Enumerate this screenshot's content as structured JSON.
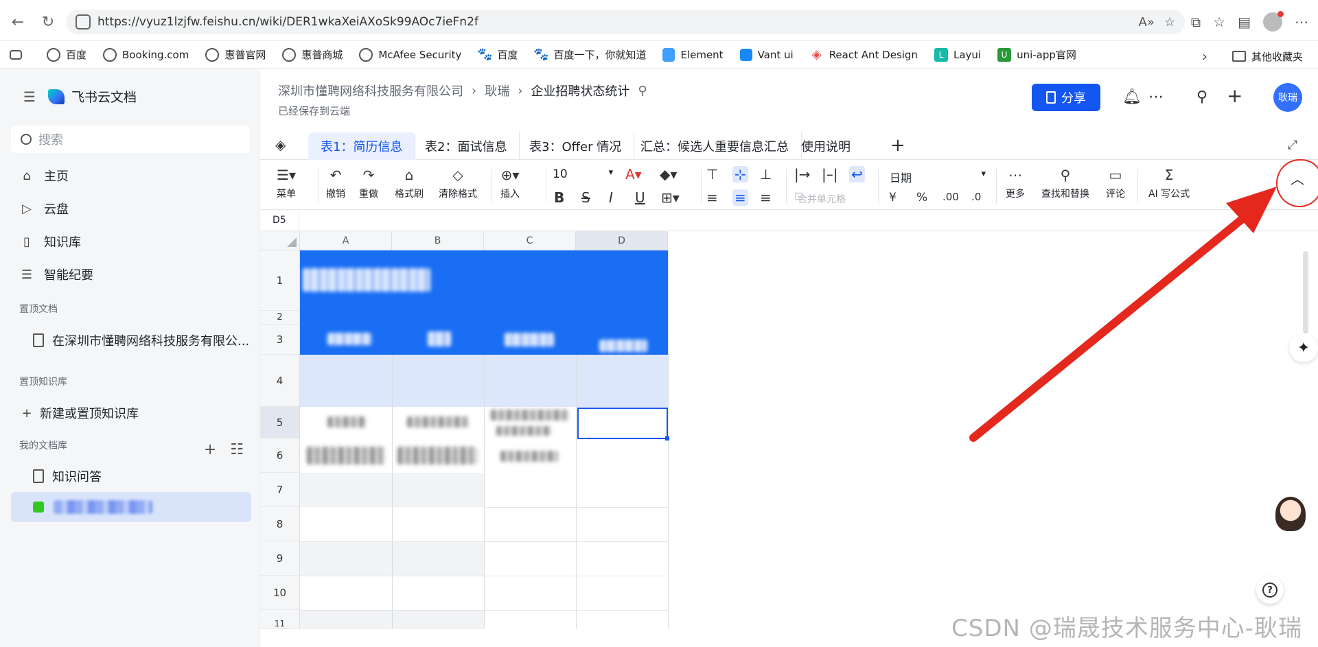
{
  "browser": {
    "url": "https://vyuz1lzjfw.feishu.cn/wiki/DER1wkaXeiAXoSk99AOc7ieFn2f",
    "read_aloud_label": "A"
  },
  "bookmarks": [
    {
      "label": "百度",
      "icon": "globe-icon"
    },
    {
      "label": "Booking.com",
      "icon": "globe-icon"
    },
    {
      "label": "惠普官网",
      "icon": "globe-icon"
    },
    {
      "label": "惠普商城",
      "icon": "globe-icon"
    },
    {
      "label": "McAfee Security",
      "icon": "globe-icon"
    },
    {
      "label": "百度",
      "icon": "paw-icon"
    },
    {
      "label": "百度一下，你就知道",
      "icon": "paw-icon"
    },
    {
      "label": "Element",
      "icon": "element-icon"
    },
    {
      "label": "Vant ui",
      "icon": "vant-icon"
    },
    {
      "label": "React Ant Design",
      "icon": "ant-icon"
    },
    {
      "label": "Layui",
      "icon": "layui-icon"
    },
    {
      "label": "uni-app官网",
      "icon": "uniapp-icon"
    }
  ],
  "bookmarks_other": "其他收藏夹",
  "sidebar": {
    "app_name": "飞书云文档",
    "search_placeholder": "搜索",
    "nav": [
      {
        "label": "主页",
        "icon": "home-icon"
      },
      {
        "label": "云盘",
        "icon": "drive-icon"
      },
      {
        "label": "知识库",
        "icon": "book-icon"
      },
      {
        "label": "智能纪要",
        "icon": "notes-icon"
      }
    ],
    "pinned_docs_title": "置顶文档",
    "pinned_doc": "在深圳市懂聘网络科技服务有限公...",
    "pinned_kb_title": "置顶知识库",
    "new_kb": "新建或置顶知识库",
    "my_docs_title": "我的文档库",
    "docs": [
      {
        "label": "知识问答"
      }
    ]
  },
  "header": {
    "breadcrumb": [
      "深圳市懂聘网络科技服务有限公司",
      "耿瑞",
      "企业招聘状态统计"
    ],
    "saved_status": "已经保存到云端",
    "share_label": "分享",
    "user_initials": "耿瑞"
  },
  "tabs": [
    {
      "label": "表1：简历信息",
      "active": true
    },
    {
      "label": "表2：面试信息",
      "active": false
    },
    {
      "label": "表3：Offer 情况",
      "active": false
    },
    {
      "label": "汇总：候选人重要信息汇总",
      "active": false
    },
    {
      "label": "使用说明",
      "active": false
    }
  ],
  "toolbar": {
    "menu": "菜单",
    "undo": "撤销",
    "redo": "重做",
    "format_painter": "格式刷",
    "clear_format": "清除格式",
    "insert": "插入",
    "font_size": "10",
    "number_format": "日期",
    "merge_cells": "合并单元格",
    "more": "更多",
    "find_replace": "查找和替换",
    "comment": "评论",
    "ai_formula": "AI 写公式",
    "currency": "¥",
    "percent": "%"
  },
  "formula_bar": {
    "cell_ref": "D5"
  },
  "grid": {
    "columns": [
      "A",
      "B",
      "C",
      "D"
    ],
    "rows": [
      "1",
      "2",
      "3",
      "4",
      "5",
      "6",
      "7",
      "8",
      "9",
      "10",
      "11"
    ],
    "selected_column": "D",
    "selected_row": "5"
  },
  "watermark": "CSDN @瑞晟技术服务中心-耿瑞",
  "colors": {
    "accent": "#1456f0",
    "header_band": "#1a6ef3",
    "subheader_band": "#dde7fc",
    "annotation_red": "#e5281e"
  }
}
